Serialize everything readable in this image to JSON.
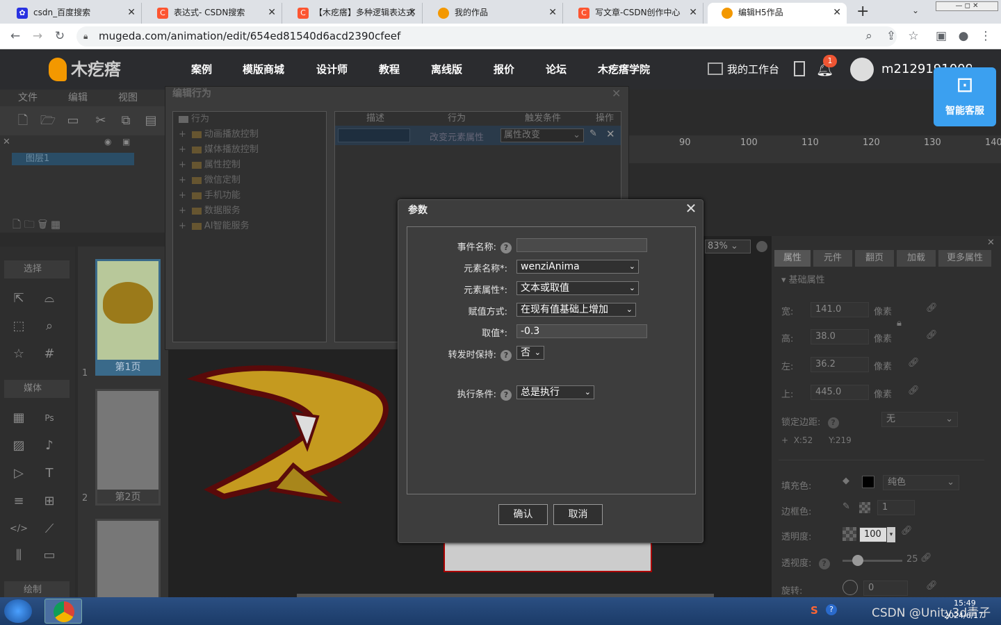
{
  "browser": {
    "tabs": [
      {
        "title": "csdn_百度搜索",
        "icon": "baidu-icon",
        "color": "#2932e1"
      },
      {
        "title": "表达式- CSDN搜索",
        "icon": "csdn-icon",
        "color": "#fc5531"
      },
      {
        "title": "【木疙瘩】多种逻辑表达式",
        "icon": "csdn-icon",
        "color": "#fc5531"
      },
      {
        "title": "我的作品",
        "icon": "mugeda-icon",
        "color": "#f39800"
      },
      {
        "title": "写文章-CSDN创作中心",
        "icon": "csdn-icon",
        "color": "#fc5531"
      },
      {
        "title": "编辑H5作品",
        "icon": "mugeda-icon",
        "color": "#f39800"
      }
    ],
    "url": "mugeda.com/animation/edit/654ed81540d6acd2390cfeef",
    "new_tab": "+",
    "close_glyph": "✕"
  },
  "site": {
    "logo": "木疙瘩",
    "nav": [
      "案例",
      "模版商城",
      "设计师",
      "教程",
      "离线版",
      "报价",
      "论坛",
      "木疙瘩学院"
    ],
    "workbench": "我的工作台",
    "notifications": "1",
    "username": "m21291910099",
    "bot_label": "智能客服"
  },
  "editor": {
    "menus": [
      "文件",
      "编辑",
      "视图"
    ],
    "layer": "图层1",
    "sections": [
      "选择",
      "媒体",
      "绘制"
    ],
    "pages": [
      "第1页",
      "第2页"
    ],
    "page_numbers": [
      "1",
      "2"
    ],
    "ruler": [
      "90",
      "100",
      "110",
      "120",
      "130",
      "140"
    ],
    "zoom": "83%"
  },
  "properties": {
    "tabs": [
      "属性",
      "元件",
      "翻页",
      "加载",
      "更多属性"
    ],
    "section": "基础属性",
    "width_label": "宽:",
    "width": "141.0",
    "height_label": "高:",
    "height": "38.0",
    "left_label": "左:",
    "left": "36.2",
    "top_label": "上:",
    "top": "445.0",
    "unit": "像素",
    "lock_edge_label": "锁定边距:",
    "lock_edge": "无",
    "x": "X:52",
    "y": "Y:219",
    "fill_label": "填充色:",
    "fill_type": "纯色",
    "border_label": "边框色:",
    "border_width": "1",
    "opacity_label": "透明度:",
    "opacity": "100",
    "perspective_label": "透视度:",
    "perspective": "25",
    "rotate_label": "旋转:",
    "rotate": "0"
  },
  "behavior": {
    "title": "编辑行为",
    "tree_root": "行为",
    "tree": [
      "动画播放控制",
      "媒体播放控制",
      "属性控制",
      "微信定制",
      "手机功能",
      "数据服务",
      "AI智能服务"
    ],
    "columns": [
      "描述",
      "行为",
      "触发条件",
      "操作"
    ],
    "row_action": "改变元素属性",
    "row_trigger": "属性改变"
  },
  "dialog": {
    "title": "参数",
    "fields": [
      {
        "label": "事件名称:",
        "value": ""
      },
      {
        "label": "元素名称*:",
        "value": "wenziAnima"
      },
      {
        "label": "元素属性*:",
        "value": "文本或取值"
      },
      {
        "label": "赋值方式:",
        "value": "在现有值基础上增加"
      },
      {
        "label": "取值*:",
        "value": "-0.3"
      },
      {
        "label": "转发时保持:",
        "value": "否"
      },
      {
        "label": "执行条件:",
        "value": "总是执行"
      }
    ],
    "confirm": "确认",
    "cancel": "取消"
  },
  "taskbar": {
    "tray": "CSDN @Unity3d青子",
    "time": "15:49",
    "date": "2024/6/17"
  }
}
